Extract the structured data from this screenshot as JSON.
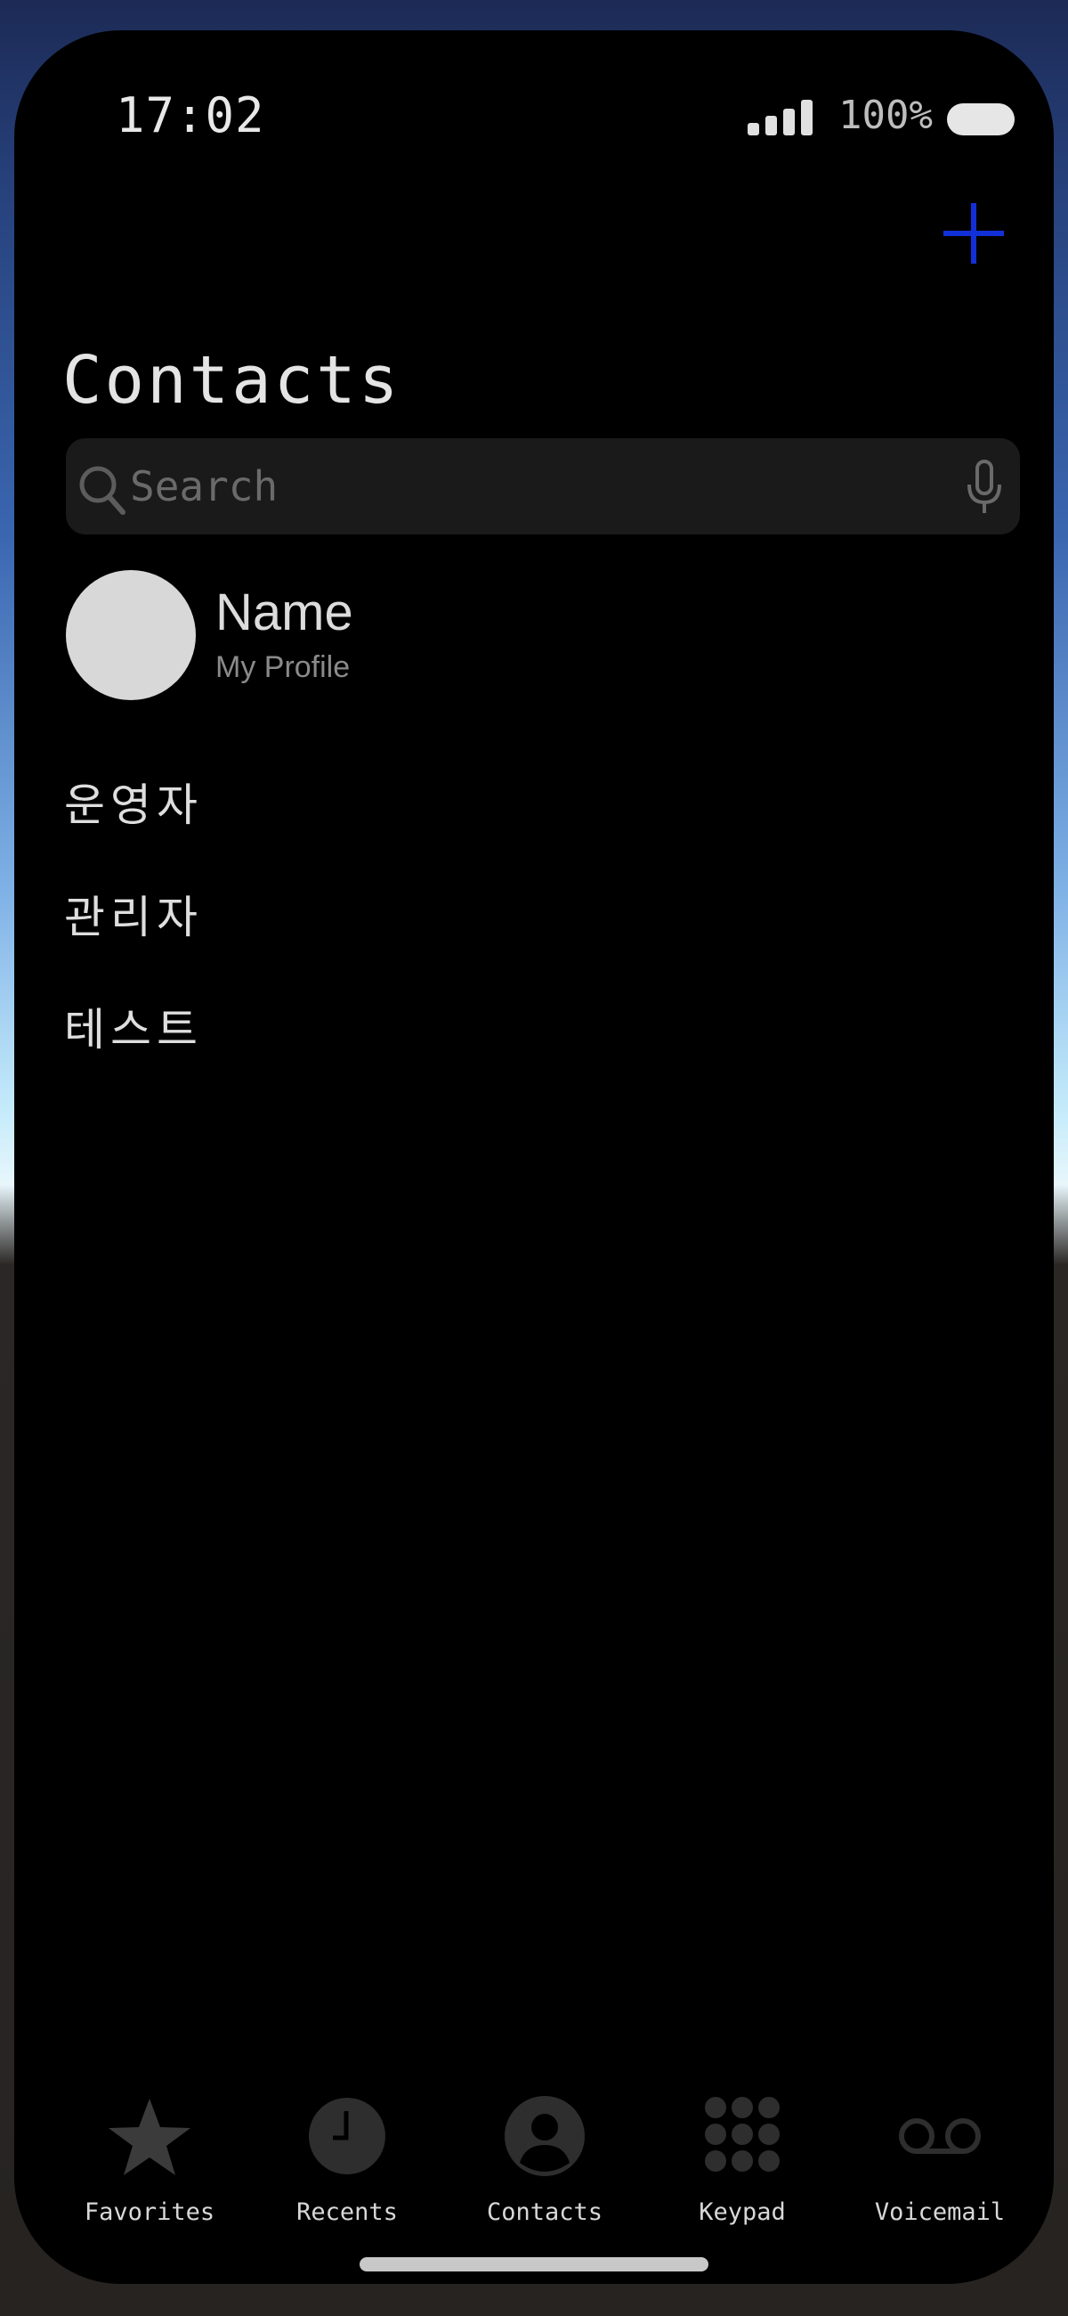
{
  "status_bar": {
    "time": "17:02",
    "battery_percent": "100%",
    "signal_bars": 4,
    "battery_level": 1.0
  },
  "header": {
    "title": "Contacts",
    "add_icon": "plus-icon",
    "accent_color": "#1230d8"
  },
  "search": {
    "placeholder": "Search",
    "value": "",
    "search_icon": "magnifier-icon",
    "mic_icon": "microphone-icon"
  },
  "profile": {
    "name": "Name",
    "subtitle": "My Profile"
  },
  "contacts": [
    {
      "name": "운영자"
    },
    {
      "name": "관리자"
    },
    {
      "name": "테스트"
    }
  ],
  "tabs": [
    {
      "label": "Favorites",
      "icon": "star-icon",
      "active": false
    },
    {
      "label": "Recents",
      "icon": "clock-icon",
      "active": false
    },
    {
      "label": "Contacts",
      "icon": "person-circle-icon",
      "active": true
    },
    {
      "label": "Keypad",
      "icon": "keypad-icon",
      "active": false
    },
    {
      "label": "Voicemail",
      "icon": "voicemail-icon",
      "active": false
    }
  ]
}
